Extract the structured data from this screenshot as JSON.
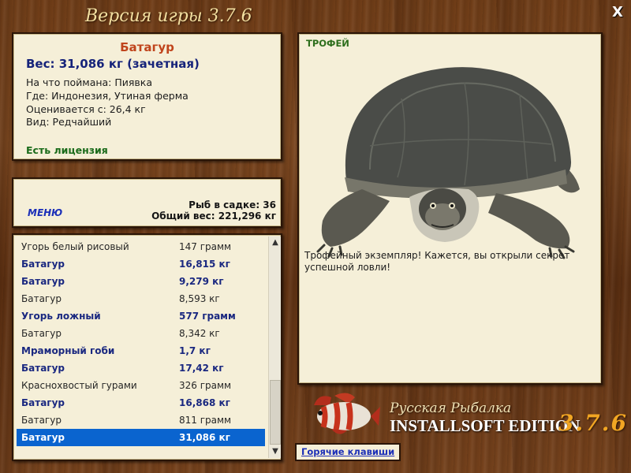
{
  "window": {
    "title": "Версия игры 3.7.6",
    "close_label": "X"
  },
  "fish_info": {
    "name": "Батагур",
    "weight_line": "Вес: 31,086 кг (зачетная)",
    "details": [
      "На что поймана: Пиявка",
      "Где: Индонезия, Утиная ферма",
      "Оценивается с: 26,4 кг",
      "Вид: Редчайший"
    ],
    "license": "Есть лицензия"
  },
  "menu": {
    "label": "МЕНЮ",
    "fish_in_cage": "Рыб в садке: 36",
    "total_weight": "Общий вес: 221,296 кг"
  },
  "catch_list": {
    "rows": [
      {
        "name": "Угорь белый рисовый",
        "weight": "147 грамм",
        "style": "normal"
      },
      {
        "name": "Батагур",
        "weight": "16,815 кг",
        "style": "bold"
      },
      {
        "name": "Батагур",
        "weight": "9,279 кг",
        "style": "bold"
      },
      {
        "name": "Батагур",
        "weight": "8,593 кг",
        "style": "normal"
      },
      {
        "name": "Угорь ложный",
        "weight": "577 грамм",
        "style": "bold"
      },
      {
        "name": "Батагур",
        "weight": "8,342 кг",
        "style": "normal"
      },
      {
        "name": "Мраморный гоби",
        "weight": "1,7 кг",
        "style": "bold"
      },
      {
        "name": "Батагур",
        "weight": "17,42 кг",
        "style": "bold"
      },
      {
        "name": "Краснохвостый гурами",
        "weight": "326 грамм",
        "style": "normal"
      },
      {
        "name": "Батагур",
        "weight": "16,868 кг",
        "style": "bold"
      },
      {
        "name": "Батагур",
        "weight": "811 грамм",
        "style": "normal"
      },
      {
        "name": "Батагур",
        "weight": "31,086 кг",
        "style": "selected"
      }
    ]
  },
  "trophy": {
    "label": "ТРОФЕЙ",
    "description": "Трофейный экземпляр! Кажется, вы открыли секрет успешной ловли!"
  },
  "branding": {
    "line1": "Русская Рыбалка",
    "line2": "INSTALLSOFT EDITION",
    "version": "3.7.6"
  },
  "hotkeys_label": "Горячие клавиши",
  "colors": {
    "selected_row": "#0a64cf",
    "bold_row": "#1a2880",
    "fish_name": "#c0441c",
    "license": "#1a6b1a",
    "link": "#1b2fb8",
    "panel_bg": "#f5efd8"
  }
}
